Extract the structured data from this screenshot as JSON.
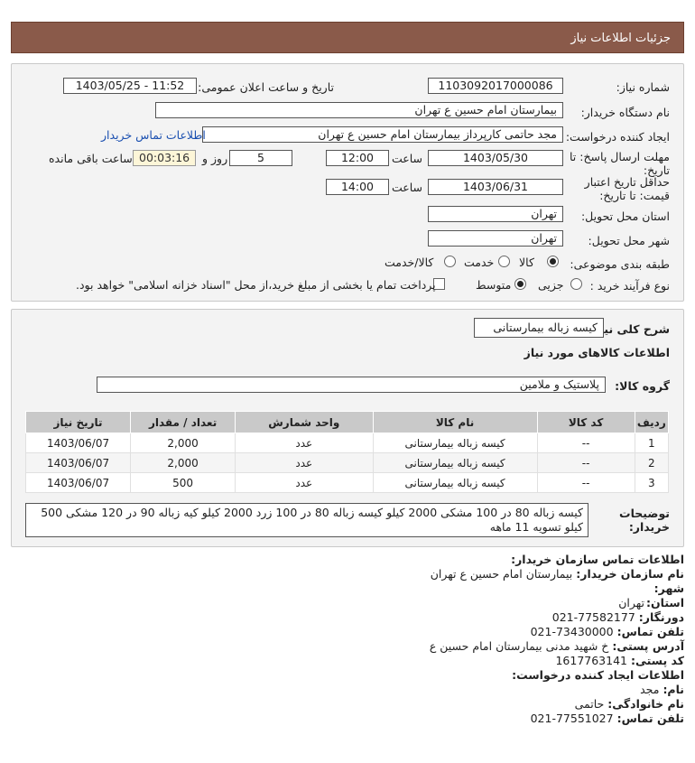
{
  "header": {
    "title": "جزئیات اطلاعات نیاز"
  },
  "need": {
    "number_label": "شماره نیاز:",
    "number": "1103092017000086",
    "announce_label": "تاریخ و ساعت اعلان عمومی:",
    "announce_value": "1403/05/25 - 11:52",
    "buyer_label": "نام دستگاه خریدار:",
    "buyer": "بیمارستان امام حسین  ع  تهران",
    "requester_label": "ایجاد کننده درخواست:",
    "requester": "مجد حاتمی کارپرداز بیمارستان امام حسین  ع  تهران",
    "contact_link": "اطلاعات تماس خریدار",
    "deadline_label_1": "مهلت ارسال پاسخ: تا",
    "deadline_label_2": "تاریخ:",
    "deadline_date": "1403/05/30",
    "time_label": "ساعت",
    "deadline_time": "12:00",
    "days_value": "5",
    "days_label": "روز و",
    "remaining_time": "00:03:16",
    "remaining_label": "ساعت باقی مانده",
    "validity_label_1": "حداقل تاریخ اعتبار",
    "validity_label_2": "قیمت: تا تاریخ:",
    "validity_date": "1403/06/31",
    "validity_time": "14:00",
    "province_label": "استان محل تحویل:",
    "province": "تهران",
    "city_label": "شهر محل تحویل:",
    "city": "تهران",
    "category_label": "طبقه بندی موضوعی:",
    "category_options": [
      "کالا",
      "خدمت",
      "کالا/خدمت"
    ],
    "category_selected": "کالا",
    "process_label": "نوع فرآیند خرید :",
    "process_options": [
      "جزیی",
      "متوسط"
    ],
    "process_selected": "متوسط",
    "payment_note": "پرداخت تمام یا بخشی از مبلغ خرید،از محل \"اسناد خزانه اسلامی\" خواهد بود."
  },
  "details": {
    "summary_label": "شرح کلی نیاز:",
    "summary": "کیسه زباله بیمارستانی",
    "goods_title": "اطلاعات کالاهای مورد نیاز",
    "group_label": "گروه کالا:",
    "group": "پلاستیک و ملامین",
    "columns": [
      "ردیف",
      "کد کالا",
      "نام کالا",
      "واحد شمارش",
      "تعداد / مقدار",
      "تاریخ نیاز"
    ],
    "rows": [
      {
        "idx": "1",
        "code": "--",
        "name": "کیسه زباله بیمارستانی",
        "unit": "عدد",
        "qty": "2,000",
        "date": "1403/06/07"
      },
      {
        "idx": "2",
        "code": "--",
        "name": "کیسه زباله بیمارستانی",
        "unit": "عدد",
        "qty": "2,000",
        "date": "1403/06/07"
      },
      {
        "idx": "3",
        "code": "--",
        "name": "کیسه زباله بیمارستانی",
        "unit": "عدد",
        "qty": "500",
        "date": "1403/06/07"
      }
    ],
    "desc_label_1": "توضیحات",
    "desc_label_2": "خریدار:",
    "description": "کیسه زباله 80 در 100 مشکی 2000 کیلو کیسه زباله 80 در 100 زرد 2000 کیلو کیه زباله 90 در 120 مشکی 500 کیلو تسویه 11 ماهه"
  },
  "contact": {
    "title": "اطلاعات تماس سازمان خریدار:",
    "org_label": "نام سازمان خریدار:",
    "org": "بیمارستان امام حسین ع تهران",
    "city_label": "شهر:",
    "city": "تهران",
    "province_label": "استان:",
    "province": "تهران",
    "fax_label": "دورنگار:",
    "fax": "77582177-021",
    "phone_label": "تلفن تماس:",
    "phone": "73430000-021",
    "address_label": "آدرس پستی:",
    "address": "خ شهید مدنی بیمارستان امام حسین ع",
    "postal_label": "کد پستی:",
    "postal": "1617763141",
    "creator_title": "اطلاعات ایجاد کننده درخواست:",
    "name_label": "نام:",
    "name": "مجد",
    "family_label": "نام خانوادگی:",
    "family": "حاتمی",
    "creator_phone_label": "تلفن تماس:",
    "creator_phone": "77551027-021"
  }
}
